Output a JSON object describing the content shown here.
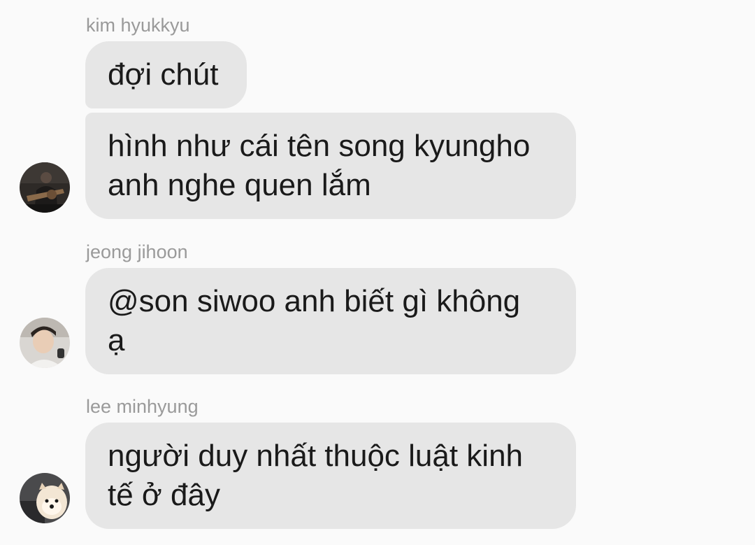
{
  "messages": [
    {
      "sender": "kim hyukkyu",
      "bubbles": [
        "đợi chút",
        "hình như cái tên song kyungho\nanh nghe quen lắm"
      ],
      "avatar_icon": "guitar-player-photo-icon"
    },
    {
      "sender": "jeong jihoon",
      "bubbles": [
        "@son siwoo anh biết gì không\nạ"
      ],
      "avatar_icon": "person-photo-icon"
    },
    {
      "sender": "lee minhyung",
      "bubbles": [
        "người duy nhất thuộc luật kinh\ntế ở đây"
      ],
      "avatar_icon": "dog-photo-icon"
    }
  ],
  "colors": {
    "background": "#fafafa",
    "bubble": "#e6e6e6",
    "sender_name": "#9a9a9a",
    "message_text": "#1a1a1a"
  }
}
